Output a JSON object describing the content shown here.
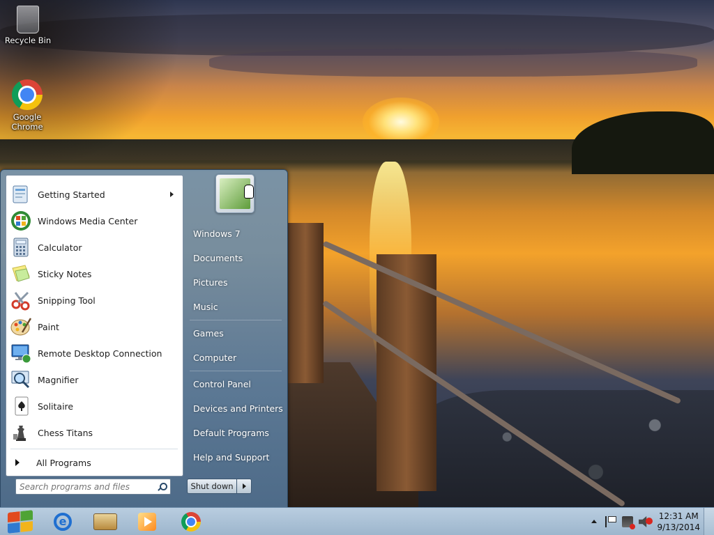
{
  "desktop": {
    "icons": [
      {
        "label": "Recycle Bin",
        "icon": "recycle-bin-icon"
      },
      {
        "label": "Google Chrome",
        "icon": "chrome-icon"
      }
    ]
  },
  "start_menu": {
    "programs": [
      {
        "label": "Getting Started",
        "icon": "getting-started-icon",
        "has_submenu": true
      },
      {
        "label": "Windows Media Center",
        "icon": "windows-media-center-icon"
      },
      {
        "label": "Calculator",
        "icon": "calculator-icon"
      },
      {
        "label": "Sticky Notes",
        "icon": "sticky-notes-icon"
      },
      {
        "label": "Snipping Tool",
        "icon": "snipping-tool-icon"
      },
      {
        "label": "Paint",
        "icon": "paint-icon"
      },
      {
        "label": "Remote Desktop Connection",
        "icon": "remote-desktop-icon"
      },
      {
        "label": "Magnifier",
        "icon": "magnifier-icon"
      },
      {
        "label": "Solitaire",
        "icon": "solitaire-icon"
      },
      {
        "label": "Chess Titans",
        "icon": "chess-titans-icon"
      }
    ],
    "all_programs": "All Programs",
    "search_placeholder": "Search programs and files",
    "places": [
      {
        "label": "Windows 7"
      },
      {
        "label": "Documents"
      },
      {
        "label": "Pictures"
      },
      {
        "label": "Music"
      },
      {
        "label": "Games"
      },
      {
        "label": "Computer"
      },
      {
        "label": "Control Panel"
      },
      {
        "label": "Devices and Printers"
      },
      {
        "label": "Default Programs"
      },
      {
        "label": "Help and Support"
      }
    ],
    "shutdown_label": "Shut down"
  },
  "taskbar": {
    "pinned": [
      {
        "name": "internet-explorer-icon"
      },
      {
        "name": "windows-explorer-icon"
      },
      {
        "name": "windows-media-player-icon"
      },
      {
        "name": "chrome-icon"
      }
    ],
    "clock_time": "12:31 AM",
    "clock_date": "9/13/2014"
  }
}
